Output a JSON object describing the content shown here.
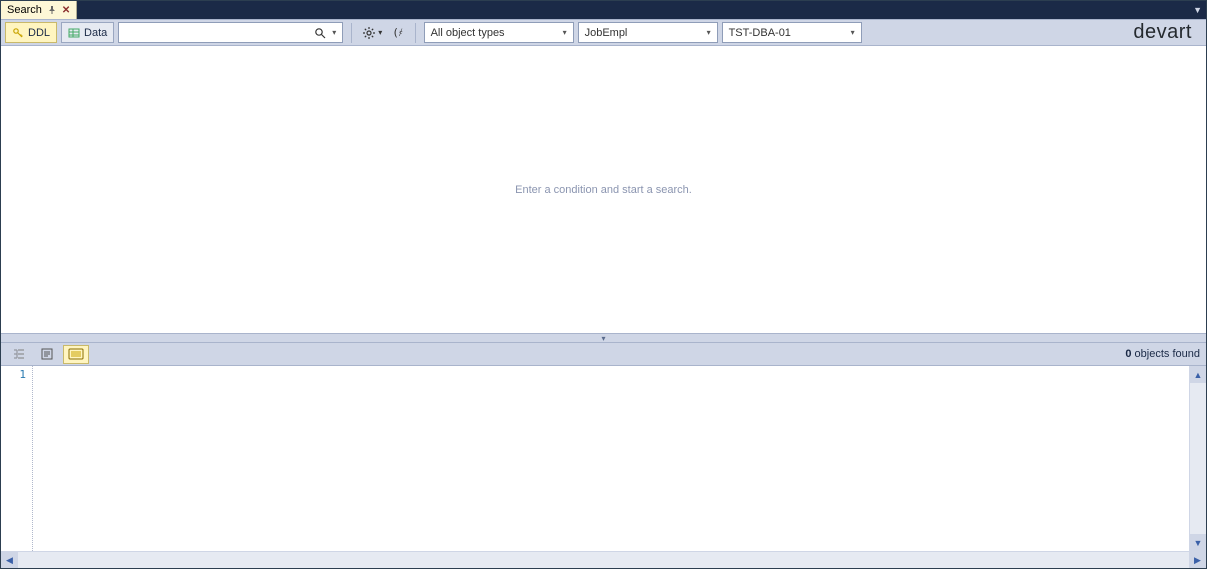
{
  "tab": {
    "label": "Search"
  },
  "toolbar": {
    "ddl_label": "DDL",
    "data_label": "Data",
    "search_value": "",
    "object_types": "All object types",
    "database": "JobEmpl",
    "server": "TST-DBA-01"
  },
  "brand": "devart",
  "upper": {
    "placeholder": "Enter a condition and start a search."
  },
  "lower": {
    "objects_count": "0",
    "objects_label": " objects found",
    "line_number": "1"
  }
}
